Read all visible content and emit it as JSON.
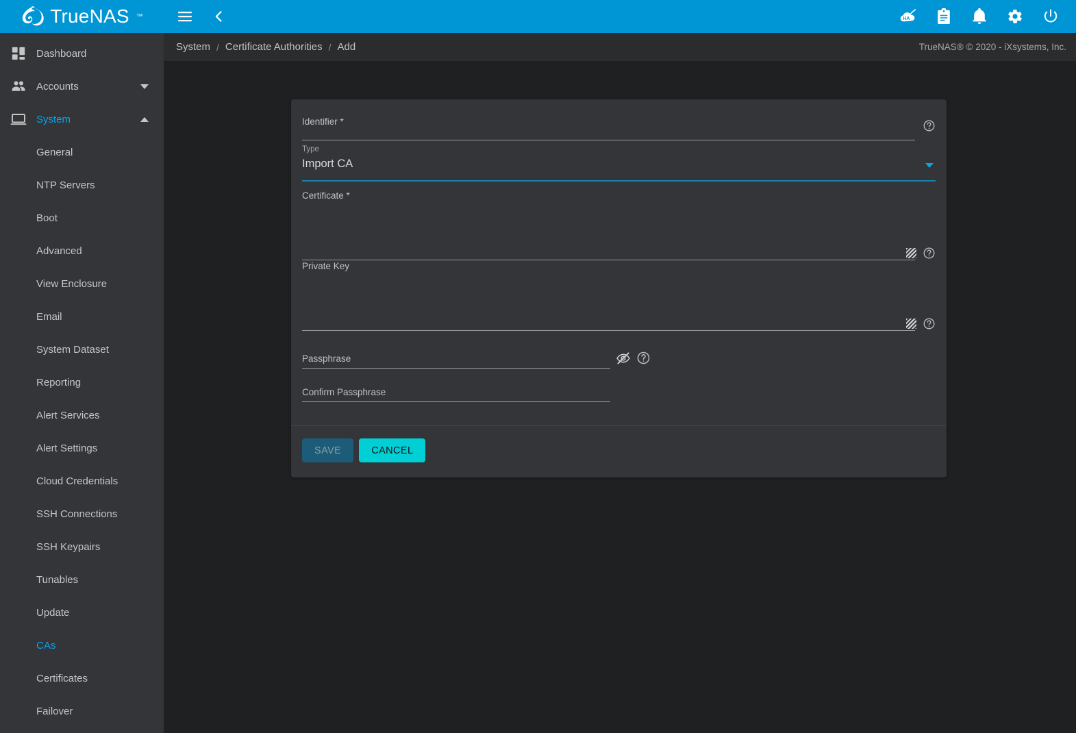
{
  "brand": {
    "name": "TrueNAS",
    "trademark": "™",
    "logo_icon": "truenas-logo-icon"
  },
  "topbar": {
    "menu_icon": "hamburger-menu-icon",
    "collapse_icon": "chevron-left-icon",
    "right_icons": [
      {
        "name": "ha-status-icon",
        "label": "HA"
      },
      {
        "name": "clipboard-icon",
        "label": ""
      },
      {
        "name": "bell-notification-icon",
        "label": ""
      },
      {
        "name": "gear-settings-icon",
        "label": ""
      },
      {
        "name": "power-icon",
        "label": ""
      }
    ]
  },
  "breadcrumb": {
    "items": [
      "System",
      "Certificate Authorities",
      "Add"
    ],
    "separator": "/",
    "copyright": "TrueNAS® © 2020 - iXsystems, Inc."
  },
  "sidebar": {
    "top_items": [
      {
        "label": "Dashboard",
        "icon": "dashboard-grid-icon",
        "active": false,
        "expandable": false
      },
      {
        "label": "Accounts",
        "icon": "people-icon",
        "active": false,
        "expandable": true,
        "expanded": false
      },
      {
        "label": "System",
        "icon": "monitor-icon",
        "active": true,
        "expandable": true,
        "expanded": true
      }
    ],
    "system_items": [
      {
        "label": "General",
        "active": false
      },
      {
        "label": "NTP Servers",
        "active": false
      },
      {
        "label": "Boot",
        "active": false
      },
      {
        "label": "Advanced",
        "active": false
      },
      {
        "label": "View Enclosure",
        "active": false
      },
      {
        "label": "Email",
        "active": false
      },
      {
        "label": "System Dataset",
        "active": false
      },
      {
        "label": "Reporting",
        "active": false
      },
      {
        "label": "Alert Services",
        "active": false
      },
      {
        "label": "Alert Settings",
        "active": false
      },
      {
        "label": "Cloud Credentials",
        "active": false
      },
      {
        "label": "SSH Connections",
        "active": false
      },
      {
        "label": "SSH Keypairs",
        "active": false
      },
      {
        "label": "Tunables",
        "active": false
      },
      {
        "label": "Update",
        "active": false
      },
      {
        "label": "CAs",
        "active": true
      },
      {
        "label": "Certificates",
        "active": false
      },
      {
        "label": "Failover",
        "active": false
      }
    ]
  },
  "form": {
    "identifier": {
      "label": "Identifier *",
      "value": "",
      "placeholder": "",
      "help_icon": "help-circle-icon"
    },
    "type": {
      "label": "Type",
      "value": "Import CA",
      "dropdown_icon": "chevron-down-icon",
      "focused": true
    },
    "certificate": {
      "label": "Certificate *",
      "value": "",
      "help_icon": "help-circle-icon",
      "resize_handle": "resize-grip-icon"
    },
    "private_key": {
      "label": "Private Key",
      "value": "",
      "help_icon": "help-circle-icon",
      "resize_handle": "resize-grip-icon"
    },
    "passphrase": {
      "label": "Passphrase",
      "value": "",
      "visibility_icon": "eye-off-icon",
      "help_icon": "help-circle-icon"
    },
    "confirm_passphrase": {
      "label": "Confirm Passphrase",
      "value": ""
    },
    "save_label": "SAVE",
    "cancel_label": "CANCEL",
    "save_disabled": true
  },
  "colors": {
    "brand_blue": "#0095d5",
    "accent_cyan": "#00d0d6",
    "active_link": "#0aa3e8",
    "page_bg": "#1f2021",
    "card_bg": "#333538",
    "sidebar_bg": "#333538",
    "breadcrumb_bg": "#2b2c2e",
    "save_disabled_bg": "#1c5c78"
  }
}
